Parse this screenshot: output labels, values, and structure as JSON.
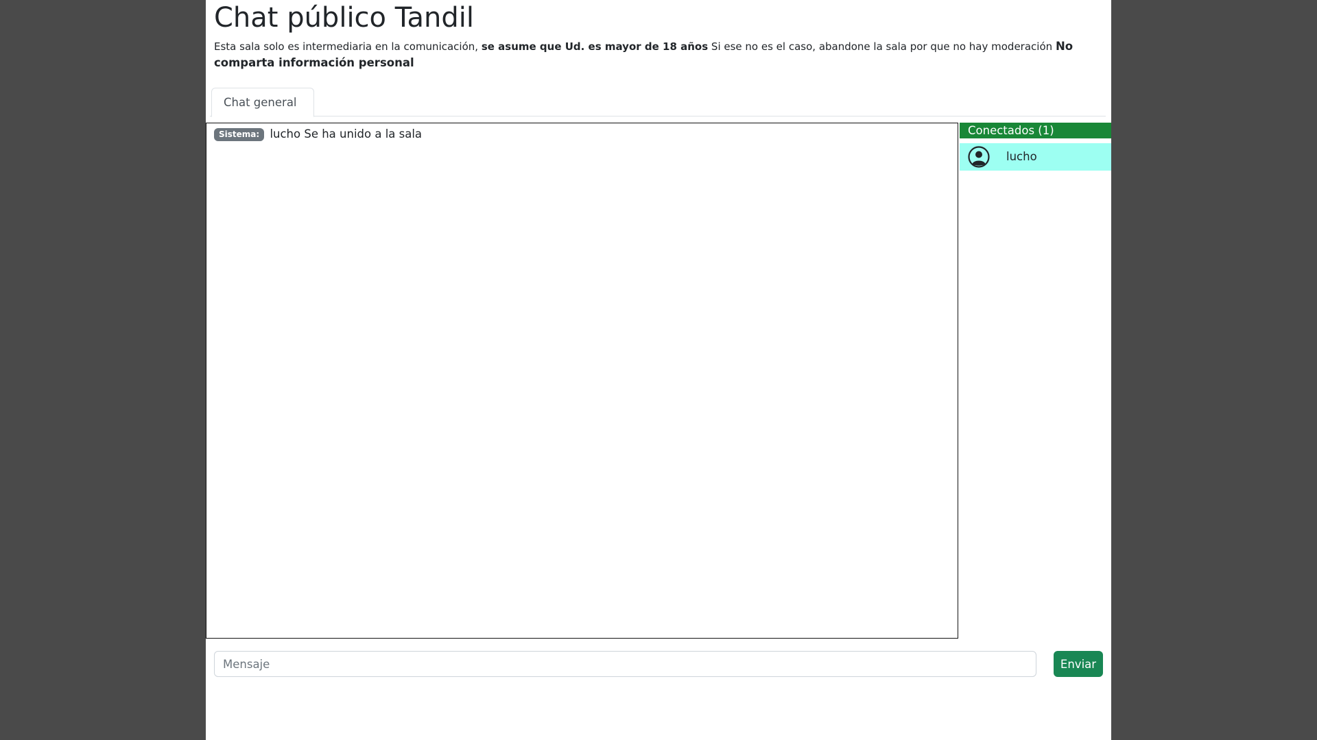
{
  "page": {
    "title": "Chat público Tandil"
  },
  "notice": {
    "part1": "Esta sala solo es intermediaria en la comunicación,",
    "bold1": "se asume que Ud. es mayor de 18 años",
    "part2": "Si ese no es el caso, abandone la sala por que no hay moderación",
    "bold2": "No comparta información personal"
  },
  "tabs": [
    {
      "label": "Chat general",
      "active": true
    }
  ],
  "messages": [
    {
      "sender": "Sistema:",
      "text": "lucho Se ha unido a la sala"
    }
  ],
  "users": {
    "header": "Conectados (1)",
    "list": [
      {
        "name": "lucho",
        "icon": "user-circle-icon"
      }
    ]
  },
  "composer": {
    "placeholder": "Mensaje",
    "value": "",
    "send_label": "Enviar"
  },
  "colors": {
    "accent": "#198754",
    "users_header": "#198737",
    "user_highlight": "#9dfff2",
    "badge": "#6c757d",
    "outside_background": "#4a4a4a"
  }
}
